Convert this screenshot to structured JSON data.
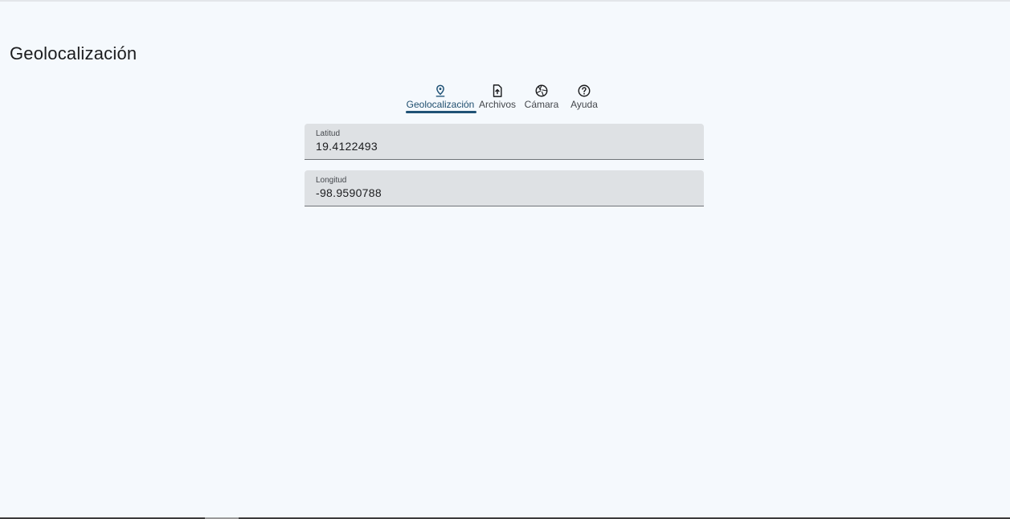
{
  "header": {
    "title": "Geolocalización"
  },
  "tabs": [
    {
      "label": "Geolocalización",
      "icon": "location-pin-icon",
      "active": true
    },
    {
      "label": "Archivos",
      "icon": "file-upload-icon",
      "active": false
    },
    {
      "label": "Cámara",
      "icon": "camera-shutter-icon",
      "active": false
    },
    {
      "label": "Ayuda",
      "icon": "help-icon",
      "active": false
    }
  ],
  "form": {
    "latitude": {
      "label": "Latitud",
      "value": "19.4122493"
    },
    "longitude": {
      "label": "Longitud",
      "value": "-98.9590788"
    }
  },
  "colors": {
    "background": "#f5f9fd",
    "accent": "#1f5276",
    "field_fill": "#dee1e4"
  }
}
